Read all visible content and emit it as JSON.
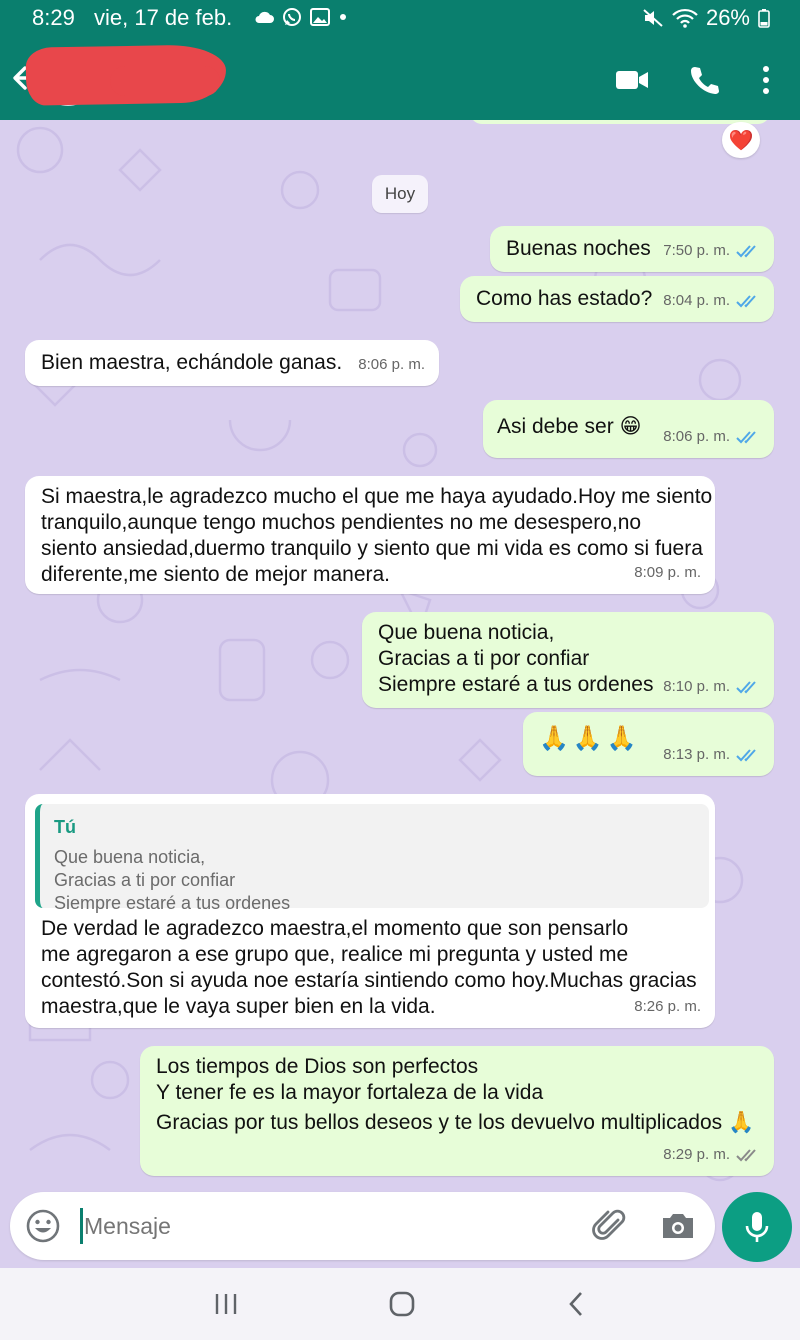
{
  "status_bar": {
    "time": "8:29",
    "date": "vie, 17 de feb.",
    "battery": "26%"
  },
  "colors": {
    "header": "#0a7f6e",
    "wallpaper": "#d9cfee",
    "outgoing_bubble": "#e7fdd8",
    "incoming_bubble": "#ffffff",
    "read_ticks": "#4fa7e8",
    "accent": "#0c9e83"
  },
  "header": {
    "back_icon": "arrow-left-icon",
    "video_icon": "video-call-icon",
    "call_icon": "phone-icon",
    "menu_icon": "more-vert-icon"
  },
  "chat": {
    "reaction": "❤️",
    "date_divider": "Hoy",
    "messages": [
      {
        "dir": "out",
        "text": "Buenas noches",
        "time": "7:50 p. m.",
        "status": "read"
      },
      {
        "dir": "out",
        "text": "Como has estado?",
        "time": "8:04 p. m.",
        "status": "read"
      },
      {
        "dir": "in",
        "text": "Bien maestra, echándole ganas.",
        "time": "8:06 p. m."
      },
      {
        "dir": "out",
        "text": "Asi debe ser 😁",
        "time": "8:06 p. m.",
        "status": "read"
      },
      {
        "dir": "in",
        "lines": [
          "Si maestra,le agradezco mucho el que me haya ayudado.Hoy me siento",
          "tranquilo,aunque tengo muchos pendientes no me desespero,no",
          "siento ansiedad,duermo tranquilo y siento que mi vida es como si fuera",
          "diferente,me siento de mejor manera."
        ],
        "time": "8:09 p. m."
      },
      {
        "dir": "out",
        "lines": [
          "Que buena noticia,",
          "Gracias a ti por confiar",
          "Siempre estaré a tus ordenes"
        ],
        "time": "8:10 p. m.",
        "status": "read"
      },
      {
        "dir": "out",
        "text": "🙏🙏🙏",
        "time": "8:13 p. m.",
        "status": "read"
      },
      {
        "dir": "in",
        "quote": {
          "author": "Tú",
          "lines": [
            "Que buena noticia,",
            "Gracias a ti por confiar",
            "Siempre estaré a tus ordenes"
          ]
        },
        "lines": [
          "De verdad le agradezco maestra,el momento que son pensarlo",
          "me agregaron a ese grupo que, realice mi pregunta y usted me",
          "contestó.Son si ayuda noe estaría sintiendo como hoy.Muchas gracias",
          "maestra,que le vaya super bien en la vida."
        ],
        "time": "8:26 p. m."
      },
      {
        "dir": "out",
        "lines": [
          "Los tiempos de Dios son perfectos",
          "Y tener fe es la mayor fortaleza de la vida",
          "Gracias por tus bellos deseos y te los devuelvo multiplicados 🙏"
        ],
        "time": "8:29 p. m.",
        "status": "delivered"
      }
    ]
  },
  "input": {
    "placeholder": "Mensaje"
  }
}
